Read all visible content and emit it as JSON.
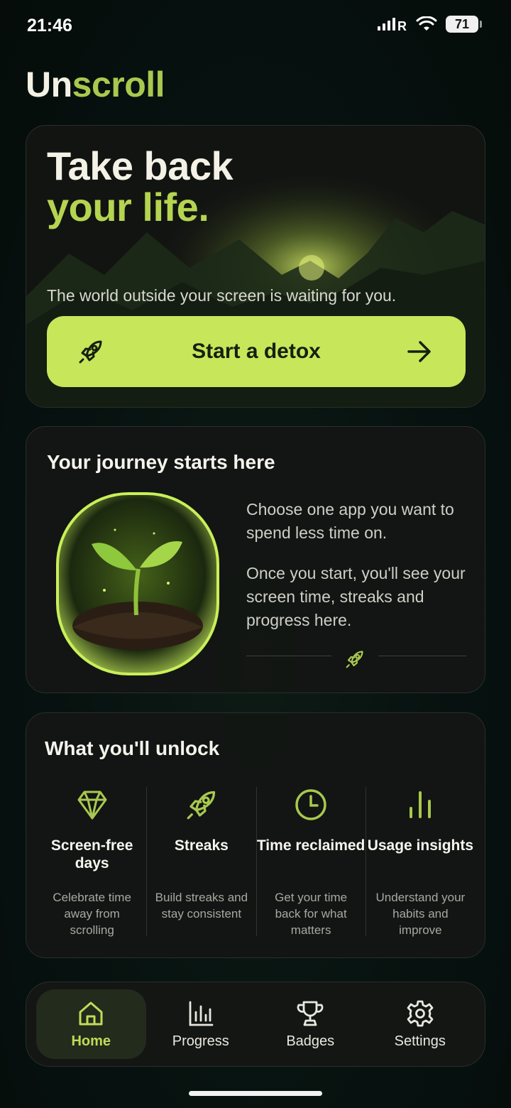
{
  "status_bar": {
    "time": "21:46",
    "battery": "71",
    "signal_icon": "signal-r-icon",
    "wifi_icon": "wifi-icon"
  },
  "app": {
    "title_part1": "Un",
    "title_part2": "scroll"
  },
  "hero": {
    "title_line1": "Take back",
    "title_line2": "your life.",
    "subtitle": "The world outside your screen is waiting for you.",
    "cta_label": "Start a detox",
    "cta_icon": "rocket-icon",
    "cta_arrow": "arrow-right-icon"
  },
  "journey": {
    "title": "Your journey starts here",
    "paragraph1": "Choose one app you want to spend less time on.",
    "paragraph2": "Once you start, you'll see your screen time, streaks and progress here.",
    "divider_icon": "rocket-icon"
  },
  "unlock": {
    "title": "What you'll unlock",
    "features": [
      {
        "icon": "diamond-icon",
        "name": "Screen-free days",
        "desc": "Celebrate time away from scrolling"
      },
      {
        "icon": "rocket-icon",
        "name": "Streaks",
        "desc": "Build streaks and stay consistent"
      },
      {
        "icon": "clock-icon",
        "name": "Time reclaimed",
        "desc": "Get your time back for what matters"
      },
      {
        "icon": "bars-icon",
        "name": "Usage insights",
        "desc": "Understand your habits and improve"
      }
    ]
  },
  "nav": {
    "items": [
      {
        "label": "Home",
        "icon": "home-icon",
        "active": true
      },
      {
        "label": "Progress",
        "icon": "chart-icon",
        "active": false
      },
      {
        "label": "Badges",
        "icon": "trophy-icon",
        "active": false
      },
      {
        "label": "Settings",
        "icon": "gear-icon",
        "active": false
      }
    ]
  },
  "colors": {
    "accent": "#c8e65a",
    "accent_text": "#b5d450",
    "background": "#071210"
  }
}
